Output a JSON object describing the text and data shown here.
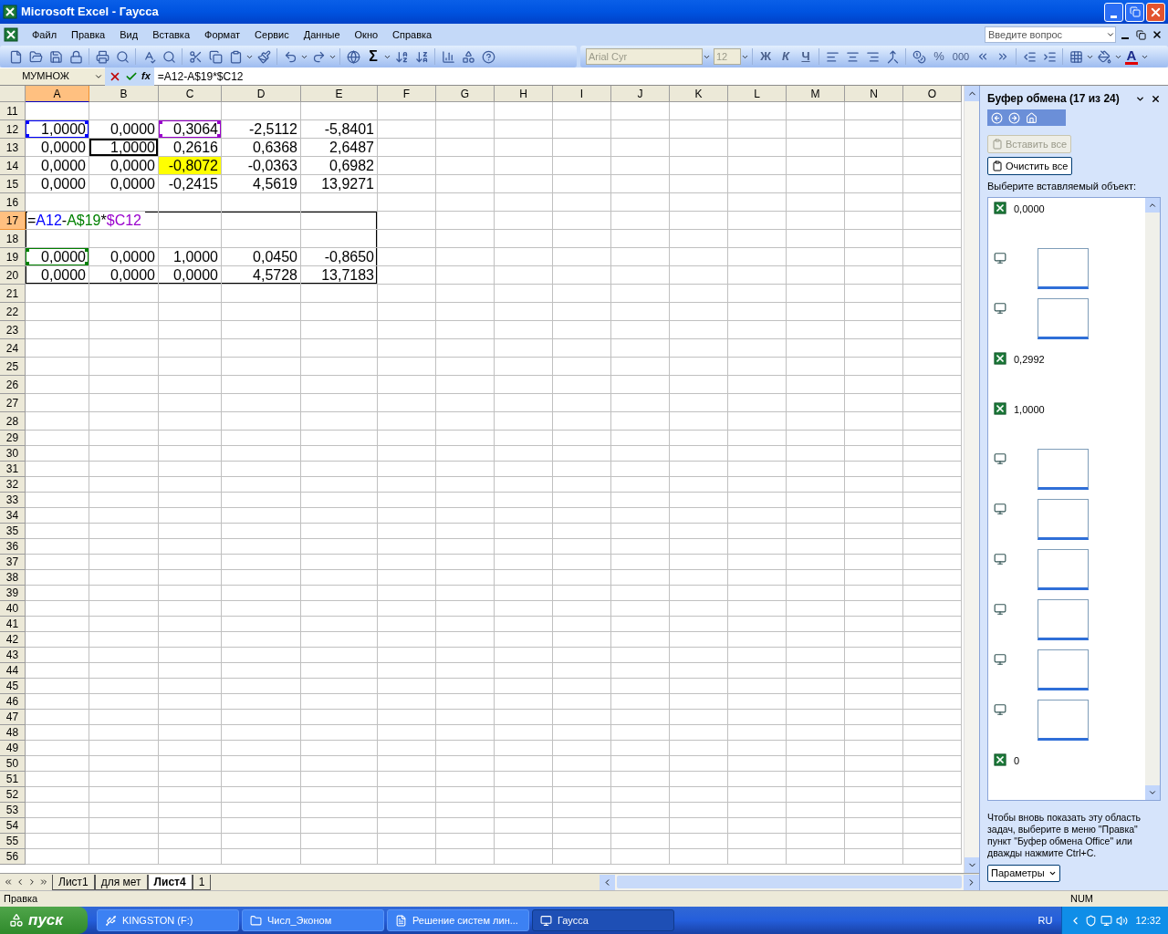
{
  "window": {
    "title": "Microsoft Excel - Гаусса"
  },
  "menu": [
    "Файл",
    "Правка",
    "Вид",
    "Вставка",
    "Формат",
    "Сервис",
    "Данные",
    "Окно",
    "Справка"
  ],
  "help_box": {
    "placeholder": "Введите вопрос"
  },
  "standard_toolbar": {
    "sum": "Σ"
  },
  "format_toolbar": {
    "font": "Arial Cyr",
    "size": "12",
    "bold": "Ж",
    "italic": "К",
    "underline": "Ч",
    "percent": "%",
    "thousands": "000",
    "font_color": "A"
  },
  "formula_bar": {
    "name_box": "МУМНОЖ",
    "fx": "fx",
    "formula": "=A12-A$19*$C12"
  },
  "columns": [
    {
      "label": "A",
      "selected": true
    },
    {
      "label": "B",
      "selected": false
    },
    {
      "label": "C",
      "selected": false
    },
    {
      "label": "D",
      "selected": false
    },
    {
      "label": "E",
      "selected": false
    },
    {
      "label": "F",
      "selected": false
    },
    {
      "label": "G",
      "selected": false
    },
    {
      "label": "H",
      "selected": false
    },
    {
      "label": "I",
      "selected": false
    },
    {
      "label": "J",
      "selected": false
    },
    {
      "label": "K",
      "selected": false
    },
    {
      "label": "L",
      "selected": false
    },
    {
      "label": "M",
      "selected": false
    },
    {
      "label": "N",
      "selected": false
    },
    {
      "label": "O",
      "selected": false
    }
  ],
  "rows": [
    {
      "number": "11",
      "selected": false,
      "framed": false,
      "cells": []
    },
    {
      "number": "12",
      "selected": false,
      "framed": false,
      "cells": [
        {
          "text": "1,0000",
          "reference": {
            "color": "#0000ff"
          }
        },
        {
          "text": "0,0000"
        },
        {
          "text": "0,3064",
          "reference": {
            "color": "#9900cc"
          }
        },
        {
          "text": "-2,5112"
        },
        {
          "text": "-5,8401"
        }
      ]
    },
    {
      "number": "13",
      "selected": false,
      "framed": false,
      "cells": [
        {
          "text": "0,0000"
        },
        {
          "text": "1,0000",
          "frame": true
        },
        {
          "text": "0,2616"
        },
        {
          "text": "0,6368"
        },
        {
          "text": "2,6487"
        }
      ]
    },
    {
      "number": "14",
      "selected": false,
      "framed": false,
      "cells": [
        {
          "text": "0,0000"
        },
        {
          "text": "0,0000"
        },
        {
          "text": "-0,8072",
          "color": "#ffff00"
        },
        {
          "text": "-0,0363"
        },
        {
          "text": "0,6982"
        }
      ]
    },
    {
      "number": "15",
      "selected": false,
      "framed": false,
      "cells": [
        {
          "text": "0,0000"
        },
        {
          "text": "0,0000"
        },
        {
          "text": "-0,2415"
        },
        {
          "text": "4,5619"
        },
        {
          "text": "13,9271"
        }
      ]
    },
    {
      "number": "16",
      "selected": false,
      "framed": false,
      "cells": []
    },
    {
      "number": "17",
      "selected": true,
      "framed": true,
      "cells": [
        {
          "kind": "formula",
          "parts": [
            {
              "text": "="
            },
            {
              "text": "A12",
              "color": "#0000ff"
            },
            {
              "text": "-"
            },
            {
              "text": "A$19",
              "color": "#008000"
            },
            {
              "text": "*"
            },
            {
              "text": "$C12",
              "color": "#9900cc"
            }
          ]
        }
      ]
    },
    {
      "number": "18",
      "selected": false,
      "framed": true,
      "cells": []
    },
    {
      "number": "19",
      "selected": false,
      "framed": true,
      "cells": [
        {
          "text": "0,0000",
          "reference": {
            "color": "#008000"
          }
        },
        {
          "text": "0,0000"
        },
        {
          "text": "1,0000"
        },
        {
          "text": "0,0450"
        },
        {
          "text": "-0,8650"
        }
      ]
    },
    {
      "number": "20",
      "selected": false,
      "framed": true,
      "cells": [
        {
          "text": "0,0000"
        },
        {
          "text": "0,0000"
        },
        {
          "text": "0,0000"
        },
        {
          "text": "4,5728"
        },
        {
          "text": "13,7183"
        }
      ]
    },
    {
      "number": "21",
      "selected": false,
      "framed": false,
      "cells": []
    },
    {
      "number": "22",
      "selected": false,
      "framed": false,
      "cells": []
    },
    {
      "number": "23",
      "selected": false,
      "framed": false,
      "cells": []
    },
    {
      "number": "24",
      "selected": false,
      "framed": false,
      "cells": []
    },
    {
      "number": "25",
      "selected": false,
      "framed": false,
      "cells": []
    },
    {
      "number": "26",
      "selected": false,
      "framed": false,
      "cells": []
    },
    {
      "number": "27",
      "selected": false,
      "framed": false,
      "cells": []
    },
    {
      "number": "28",
      "selected": false,
      "framed": false,
      "cells": []
    },
    {
      "number": "29",
      "selected": false,
      "framed": false,
      "cells": []
    },
    {
      "number": "30",
      "selected": false,
      "framed": false,
      "cells": []
    },
    {
      "number": "31",
      "selected": false,
      "framed": false,
      "cells": []
    },
    {
      "number": "32",
      "selected": false,
      "framed": false,
      "cells": []
    },
    {
      "number": "33",
      "selected": false,
      "framed": false,
      "cells": []
    },
    {
      "number": "34",
      "selected": false,
      "framed": false,
      "cells": []
    },
    {
      "number": "35",
      "selected": false,
      "framed": false,
      "cells": []
    },
    {
      "number": "36",
      "selected": false,
      "framed": false,
      "cells": []
    },
    {
      "number": "37",
      "selected": false,
      "framed": false,
      "cells": []
    },
    {
      "number": "38",
      "selected": false,
      "framed": false,
      "cells": []
    },
    {
      "number": "39",
      "selected": false,
      "framed": false,
      "cells": []
    },
    {
      "number": "40",
      "selected": false,
      "framed": false,
      "cells": []
    },
    {
      "number": "41",
      "selected": false,
      "framed": false,
      "cells": []
    },
    {
      "number": "42",
      "selected": false,
      "framed": false,
      "cells": []
    },
    {
      "number": "43",
      "selected": false,
      "framed": false,
      "cells": []
    },
    {
      "number": "44",
      "selected": false,
      "framed": false,
      "cells": []
    },
    {
      "number": "45",
      "selected": false,
      "framed": false,
      "cells": []
    },
    {
      "number": "46",
      "selected": false,
      "framed": false,
      "cells": []
    },
    {
      "number": "47",
      "selected": false,
      "framed": false,
      "cells": []
    },
    {
      "number": "48",
      "selected": false,
      "framed": false,
      "cells": []
    },
    {
      "number": "49",
      "selected": false,
      "framed": false,
      "cells": []
    },
    {
      "number": "50",
      "selected": false,
      "framed": false,
      "cells": []
    },
    {
      "number": "51",
      "selected": false,
      "framed": false,
      "cells": []
    },
    {
      "number": "52",
      "selected": false,
      "framed": false,
      "cells": []
    },
    {
      "number": "53",
      "selected": false,
      "framed": false,
      "cells": []
    },
    {
      "number": "54",
      "selected": false,
      "framed": false,
      "cells": []
    },
    {
      "number": "55",
      "selected": false,
      "framed": false,
      "cells": []
    },
    {
      "number": "56",
      "selected": false,
      "framed": false,
      "cells": []
    }
  ],
  "sheet_tabs": [
    {
      "label": "Лист1",
      "selected": false
    },
    {
      "label": "для мет",
      "selected": false
    },
    {
      "label": "Лист4",
      "selected": true
    },
    {
      "label": "1",
      "selected": false
    }
  ],
  "task_pane": {
    "title": "Буфер обмена (17 из 24)",
    "buttons": [
      {
        "label": "Вставить все",
        "disabled": true
      },
      {
        "label": "Очистить все",
        "disabled": false
      }
    ],
    "prompt": "Выберите вставляемый объект:",
    "items": [
      {
        "kind": "text",
        "text": "0,0000"
      },
      {
        "kind": "image"
      },
      {
        "kind": "image"
      },
      {
        "kind": "text",
        "text": "0,2992"
      },
      {
        "kind": "text",
        "text": "1,0000"
      },
      {
        "kind": "image"
      },
      {
        "kind": "image"
      },
      {
        "kind": "image"
      },
      {
        "kind": "image"
      },
      {
        "kind": "image"
      },
      {
        "kind": "image"
      },
      {
        "kind": "text",
        "text": "0"
      }
    ],
    "hint": "Чтобы вновь показать эту область задач, выберите в меню \"Правка\" пункт \"Буфер обмена Office\" или дважды нажмите Ctrl+C.",
    "options_button": "Параметры"
  },
  "status_bar": {
    "mode": "Правка",
    "num": "NUM"
  },
  "taskbar": {
    "start": "пуск",
    "tasks": [
      {
        "label": "KINGSTON (F:)",
        "selected": false
      },
      {
        "label": "Числ_Эконом",
        "selected": false
      },
      {
        "label": "Решение систем лин...",
        "selected": false
      },
      {
        "label": "Гаусса",
        "selected": true
      }
    ],
    "language": "RU",
    "clock": "12:32"
  }
}
